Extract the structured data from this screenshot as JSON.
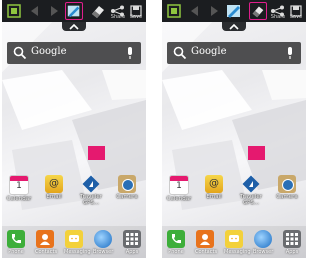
{
  "toolbar": {
    "share_label": "Share",
    "save_label": "Save"
  },
  "search": {
    "placeholder": "Google"
  },
  "home_apps": [
    {
      "label": "Calendar",
      "icon": "calendar-icon",
      "badge": "1"
    },
    {
      "label": "Email",
      "icon": "email-icon"
    },
    {
      "label": "Traveler\nGPS...",
      "icon": "traveler-gps-icon"
    },
    {
      "label": "Camera",
      "icon": "camera-icon"
    }
  ],
  "dock": [
    {
      "label": "Phone",
      "icon": "phone-icon"
    },
    {
      "label": "Contacts",
      "icon": "contacts-icon"
    },
    {
      "label": "Messaging",
      "icon": "messaging-icon"
    },
    {
      "label": "Browser",
      "icon": "browser-icon"
    },
    {
      "label": "Apps",
      "icon": "apps-grid-icon"
    }
  ],
  "colors": {
    "accent": "#e01e8c",
    "toolbar_bg": "#1b1d20",
    "wallpaper_pink": "#e5196f"
  }
}
